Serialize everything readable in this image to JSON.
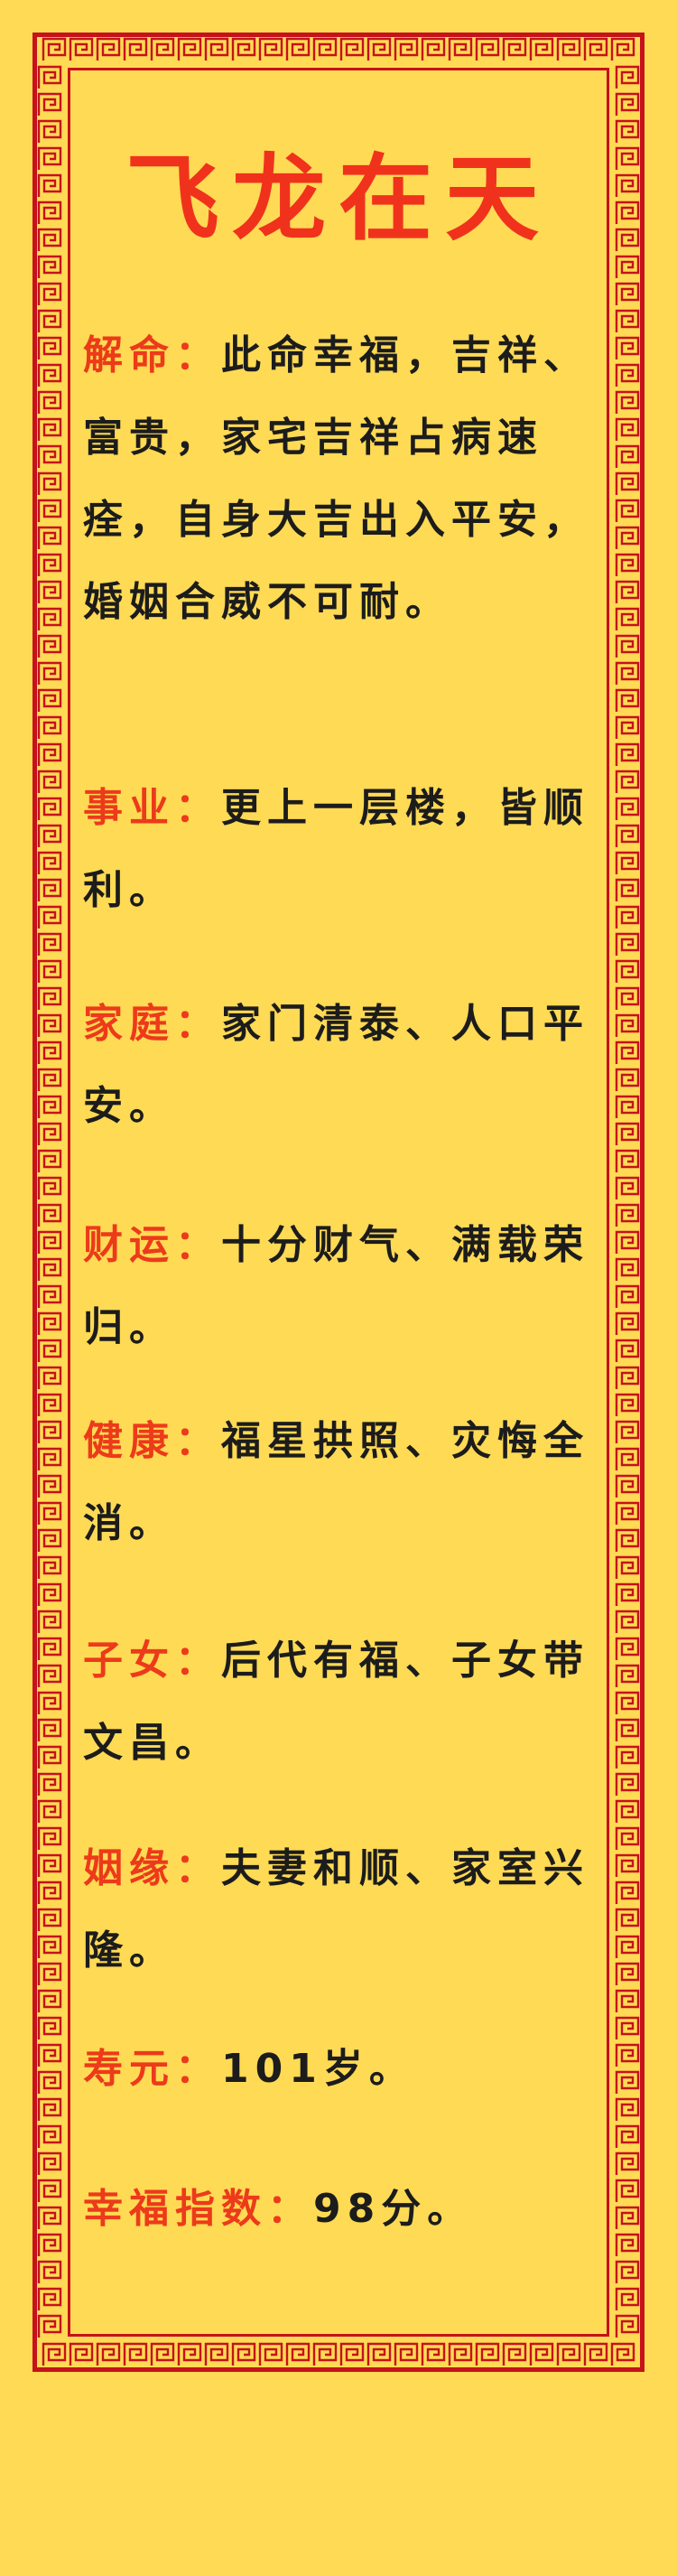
{
  "title": "飞龙在天",
  "colors": {
    "background": "#FFDA55",
    "border": "#C5121B",
    "title": "#F0321D",
    "label": "#EC3A1A",
    "text": "#1C1C1C"
  },
  "sections": {
    "jieming": {
      "label": "解命：",
      "text": "此命幸福，吉祥、富贵，家宅吉祥占病速痊，自身大吉出入平安，婚姻合威不可耐。"
    },
    "shiye": {
      "label": "事业：",
      "text": "更上一层楼，皆顺利。"
    },
    "jiating": {
      "label": "家庭：",
      "text": "家门清泰、人口平安。"
    },
    "caiyun": {
      "label": "财运：",
      "text": "十分财气、满载荣归。"
    },
    "jiankang": {
      "label": "健康：",
      "text": "福星拱照、灾悔全消。"
    },
    "zinv": {
      "label": "子女：",
      "text": "后代有福、子女带文昌。"
    },
    "yinyuan": {
      "label": "姻缘：",
      "text": "夫妻和顺、家室兴隆。"
    },
    "shouyuan": {
      "label": "寿元：",
      "text": "101岁。"
    },
    "xingfu": {
      "label": "幸福指数：",
      "text": "98分。"
    }
  }
}
